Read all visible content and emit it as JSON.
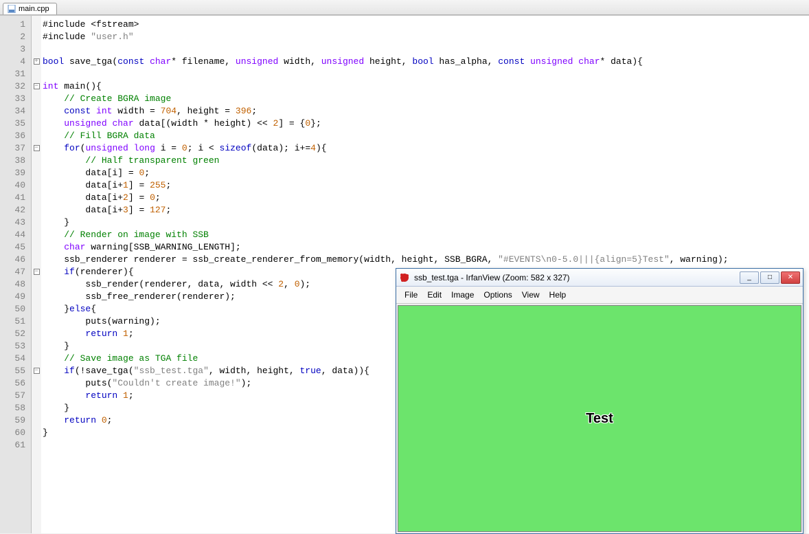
{
  "tab": {
    "filename": "main.cpp"
  },
  "gutter_lines": [
    "1",
    "2",
    "3",
    "4",
    "31",
    "32",
    "33",
    "34",
    "35",
    "36",
    "37",
    "38",
    "39",
    "40",
    "41",
    "42",
    "43",
    "44",
    "45",
    "46",
    "47",
    "48",
    "49",
    "50",
    "51",
    "52",
    "53",
    "54",
    "55",
    "56",
    "57",
    "58",
    "59",
    "60",
    "61"
  ],
  "fold_markers": {
    "1": "",
    "2": "",
    "3": "",
    "4": "plus",
    "31": "",
    "32": "minus",
    "33": "",
    "34": "",
    "35": "",
    "36": "",
    "37": "minus",
    "38": "",
    "39": "",
    "40": "",
    "41": "",
    "42": "",
    "43": "",
    "44": "",
    "45": "",
    "46": "",
    "47": "minus",
    "48": "",
    "49": "",
    "50": "",
    "51": "",
    "52": "",
    "53": "",
    "54": "",
    "55": "minus",
    "56": "",
    "57": "",
    "58": "",
    "59": "",
    "60": "",
    "61": ""
  },
  "code": {
    "l1": {
      "p": [
        "#include <fstream>"
      ]
    },
    "l2": {
      "p": [
        "#include ",
        {
          "c": "st",
          "t": "\"user.h\""
        }
      ]
    },
    "l3": {
      "p": [
        ""
      ]
    },
    "l4": {
      "p": [
        {
          "c": "kw",
          "t": "bool"
        },
        " save_tga(",
        {
          "c": "kw",
          "t": "const"
        },
        " ",
        {
          "c": "ty",
          "t": "char"
        },
        "* filename, ",
        {
          "c": "ty",
          "t": "unsigned"
        },
        " width, ",
        {
          "c": "ty",
          "t": "unsigned"
        },
        " height, ",
        {
          "c": "kw",
          "t": "bool"
        },
        " has_alpha, ",
        {
          "c": "kw",
          "t": "const"
        },
        " ",
        {
          "c": "ty",
          "t": "unsigned"
        },
        " ",
        {
          "c": "ty",
          "t": "char"
        },
        "* data){"
      ]
    },
    "l31": {
      "p": [
        ""
      ]
    },
    "l32": {
      "p": [
        {
          "c": "ty",
          "t": "int"
        },
        " main(){"
      ]
    },
    "l33": {
      "p": [
        "    ",
        {
          "c": "cm",
          "t": "// Create BGRA image"
        }
      ]
    },
    "l34": {
      "p": [
        "    ",
        {
          "c": "kw",
          "t": "const"
        },
        " ",
        {
          "c": "ty",
          "t": "int"
        },
        " width = ",
        {
          "c": "nu",
          "t": "704"
        },
        ", height = ",
        {
          "c": "nu",
          "t": "396"
        },
        ";"
      ]
    },
    "l35": {
      "p": [
        "    ",
        {
          "c": "ty",
          "t": "unsigned"
        },
        " ",
        {
          "c": "ty",
          "t": "char"
        },
        " data[(width * height) << ",
        {
          "c": "nu",
          "t": "2"
        },
        "] = {",
        {
          "c": "nu",
          "t": "0"
        },
        "};"
      ]
    },
    "l36": {
      "p": [
        "    ",
        {
          "c": "cm",
          "t": "// Fill BGRA data"
        }
      ]
    },
    "l37": {
      "p": [
        "    ",
        {
          "c": "kw",
          "t": "for"
        },
        "(",
        {
          "c": "ty",
          "t": "unsigned"
        },
        " ",
        {
          "c": "ty",
          "t": "long"
        },
        " i = ",
        {
          "c": "nu",
          "t": "0"
        },
        "; i < ",
        {
          "c": "kw",
          "t": "sizeof"
        },
        "(data); i+=",
        {
          "c": "nu",
          "t": "4"
        },
        "){"
      ]
    },
    "l38": {
      "p": [
        "        ",
        {
          "c": "cm",
          "t": "// Half transparent green"
        }
      ]
    },
    "l39": {
      "p": [
        "        data[i] = ",
        {
          "c": "nu",
          "t": "0"
        },
        ";"
      ]
    },
    "l40": {
      "p": [
        "        data[i+",
        {
          "c": "nu",
          "t": "1"
        },
        "] = ",
        {
          "c": "nu",
          "t": "255"
        },
        ";"
      ]
    },
    "l41": {
      "p": [
        "        data[i+",
        {
          "c": "nu",
          "t": "2"
        },
        "] = ",
        {
          "c": "nu",
          "t": "0"
        },
        ";"
      ]
    },
    "l42": {
      "p": [
        "        data[i+",
        {
          "c": "nu",
          "t": "3"
        },
        "] = ",
        {
          "c": "nu",
          "t": "127"
        },
        ";"
      ]
    },
    "l43": {
      "p": [
        "    }"
      ]
    },
    "l44": {
      "p": [
        "    ",
        {
          "c": "cm",
          "t": "// Render on image with SSB"
        }
      ]
    },
    "l45": {
      "p": [
        "    ",
        {
          "c": "ty",
          "t": "char"
        },
        " warning[SSB_WARNING_LENGTH];"
      ]
    },
    "l46": {
      "p": [
        "    ssb_renderer renderer = ssb_create_renderer_from_memory(width, height, SSB_BGRA, ",
        {
          "c": "st",
          "t": "\"#EVENTS\\n0-5.0|||{align=5}Test\""
        },
        ", warning);"
      ]
    },
    "l47": {
      "p": [
        "    ",
        {
          "c": "kw",
          "t": "if"
        },
        "(renderer){"
      ]
    },
    "l48": {
      "p": [
        "        ssb_render(renderer, data, width << ",
        {
          "c": "nu",
          "t": "2"
        },
        ", ",
        {
          "c": "nu",
          "t": "0"
        },
        ");"
      ]
    },
    "l49": {
      "p": [
        "        ssb_free_renderer(renderer);"
      ]
    },
    "l50": {
      "p": [
        "    }",
        {
          "c": "kw",
          "t": "else"
        },
        "{"
      ]
    },
    "l51": {
      "p": [
        "        puts(warning);"
      ]
    },
    "l52": {
      "p": [
        "        ",
        {
          "c": "kw",
          "t": "return"
        },
        " ",
        {
          "c": "nu",
          "t": "1"
        },
        ";"
      ]
    },
    "l53": {
      "p": [
        "    }"
      ]
    },
    "l54": {
      "p": [
        "    ",
        {
          "c": "cm",
          "t": "// Save image as TGA file"
        }
      ]
    },
    "l55": {
      "p": [
        "    ",
        {
          "c": "kw",
          "t": "if"
        },
        "(!save_tga(",
        {
          "c": "st",
          "t": "\"ssb_test.tga\""
        },
        ", width, height, ",
        {
          "c": "kw",
          "t": "true"
        },
        ", data)){"
      ]
    },
    "l56": {
      "p": [
        "        puts(",
        {
          "c": "st",
          "t": "\"Couldn't create image!\""
        },
        ");"
      ]
    },
    "l57": {
      "p": [
        "        ",
        {
          "c": "kw",
          "t": "return"
        },
        " ",
        {
          "c": "nu",
          "t": "1"
        },
        ";"
      ]
    },
    "l58": {
      "p": [
        "    }"
      ]
    },
    "l59": {
      "p": [
        "    ",
        {
          "c": "kw",
          "t": "return"
        },
        " ",
        {
          "c": "nu",
          "t": "0"
        },
        ";"
      ]
    },
    "l60": {
      "p": [
        "}"
      ]
    },
    "l61": {
      "p": [
        ""
      ]
    }
  },
  "iv": {
    "title": "ssb_test.tga - IrfanView (Zoom: 582 x 327)",
    "menu": [
      "File",
      "Edit",
      "Image",
      "Options",
      "View",
      "Help"
    ],
    "text": "Test",
    "bg_color": "#6ce46c",
    "btn_min": "_",
    "btn_max": "□",
    "btn_close": "✕"
  }
}
